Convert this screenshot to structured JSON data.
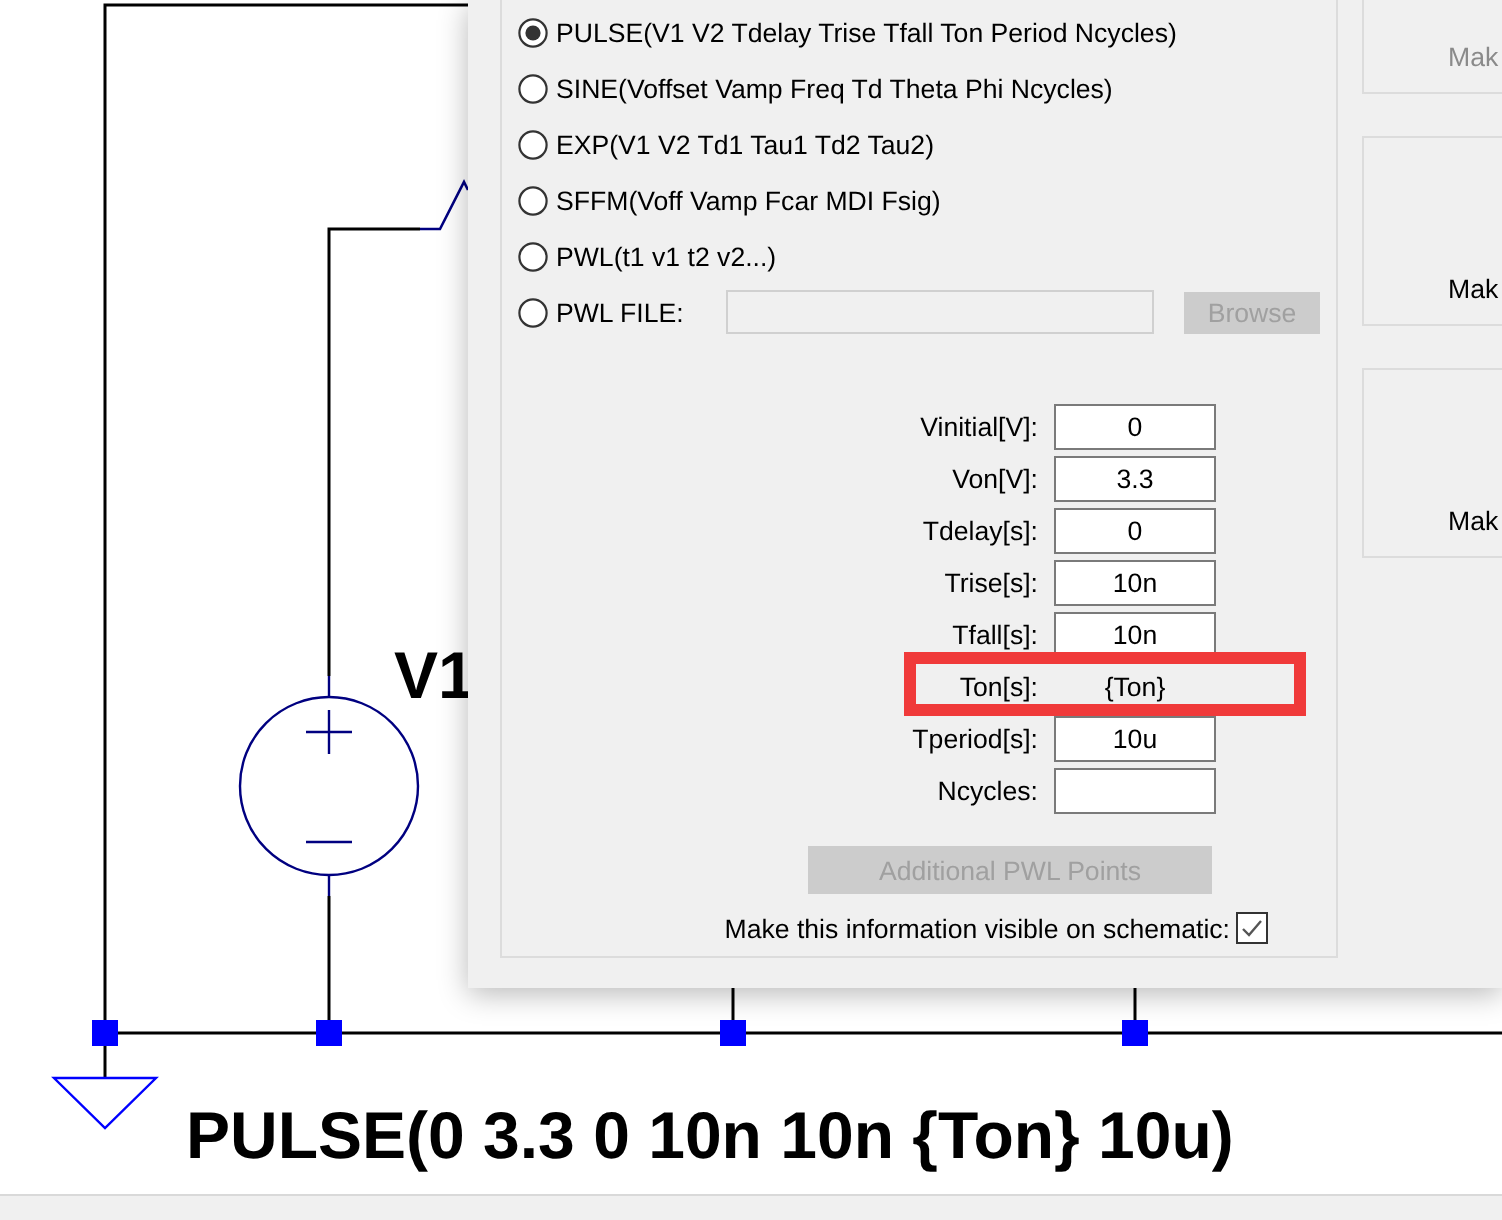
{
  "schematic": {
    "labels": [
      {
        "kind": "instance",
        "text": "V1"
      },
      {
        "kind": "value",
        "text": "PULSE(0 3.3 0 10n 10n {Ton} 10u)"
      }
    ]
  },
  "dialog": {
    "functions": [
      {
        "kind": "plain",
        "label": "PULSE(V1 V2 Tdelay Trise Tfall Ton Period Ncycles)",
        "selected": true
      },
      {
        "kind": "plain",
        "label": "SINE(Voffset Vamp Freq Td Theta Phi Ncycles)",
        "selected": false
      },
      {
        "kind": "plain",
        "label": "EXP(V1 V2 Td1 Tau1 Td2 Tau2)",
        "selected": false
      },
      {
        "kind": "plain",
        "label": "SFFM(Voff Vamp Fcar MDI Fsig)",
        "selected": false
      },
      {
        "kind": "plain",
        "label": "PWL(t1 v1 t2 v2...)",
        "selected": false
      },
      {
        "kind": "file",
        "label": "PWL FILE:",
        "selected": false,
        "field_disabled": true,
        "button": "Browse",
        "button_disabled": true
      }
    ],
    "parameters": [
      {
        "label": "Vinitial[V]:",
        "value": "0",
        "highlighted": false
      },
      {
        "label": "Von[V]:",
        "value": "3.3",
        "highlighted": false
      },
      {
        "label": "Tdelay[s]:",
        "value": "0",
        "highlighted": false
      },
      {
        "label": "Trise[s]:",
        "value": "10n",
        "highlighted": false
      },
      {
        "label": "Tfall[s]:",
        "value": "10n",
        "highlighted": false
      },
      {
        "label": "Ton[s]:",
        "value": "{Ton}",
        "highlighted": true
      },
      {
        "label": "Tperiod[s]:",
        "value": "10u",
        "highlighted": false
      },
      {
        "label": "Ncycles:",
        "highlighted": false
      }
    ],
    "pwl_points_button": {
      "label": "Additional PWL Points",
      "disabled": true
    },
    "show_on_schematic": {
      "label": "Make this information visible on schematic:",
      "checked": true
    },
    "side_panels": [
      {
        "label": "Mak",
        "disabled": true
      },
      {
        "label": "Mak",
        "disabled": false
      },
      {
        "label": "Mak",
        "disabled": false
      }
    ]
  }
}
